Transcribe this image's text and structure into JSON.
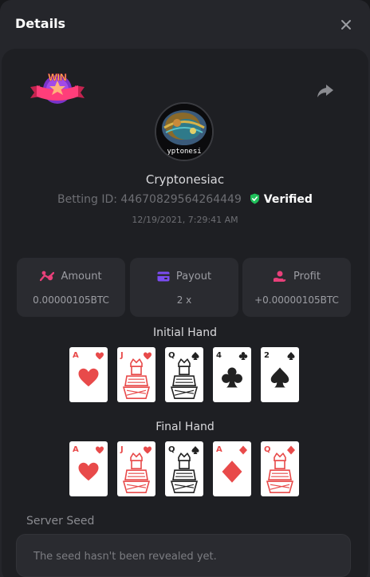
{
  "header": {
    "title": "Details"
  },
  "user": {
    "name": "Cryptonesiac",
    "avatar_text": "yptonesi",
    "betting_label": "Betting ID:",
    "betting_id": "44670829564264449",
    "verified_label": "Verified",
    "timestamp": "12/19/2021, 7:29:41 AM"
  },
  "badge": {
    "text": "WIN"
  },
  "stats": {
    "amount": {
      "label": "Amount",
      "value": "0.00000105BTC",
      "icon": "coins-icon"
    },
    "payout": {
      "label": "Payout",
      "value": "2 x",
      "icon": "wallet-icon"
    },
    "profit": {
      "label": "Profit",
      "value": "+0.00000105BTC",
      "icon": "hand-coins-icon"
    }
  },
  "initial_hand": {
    "title": "Initial Hand",
    "cards": [
      {
        "rank": "A",
        "suit": "hearts"
      },
      {
        "rank": "J",
        "suit": "hearts"
      },
      {
        "rank": "Q",
        "suit": "spades"
      },
      {
        "rank": "4",
        "suit": "clubs"
      },
      {
        "rank": "2",
        "suit": "spades"
      }
    ]
  },
  "final_hand": {
    "title": "Final Hand",
    "cards": [
      {
        "rank": "A",
        "suit": "hearts"
      },
      {
        "rank": "J",
        "suit": "hearts"
      },
      {
        "rank": "Q",
        "suit": "spades"
      },
      {
        "rank": "A",
        "suit": "diamonds"
      },
      {
        "rank": "Q",
        "suit": "diamonds"
      }
    ]
  },
  "server_seed": {
    "label": "Server Seed",
    "message": "The seed hasn't been revealed yet."
  },
  "colors": {
    "red_suit": "#e84a4a",
    "black_suit": "#222222",
    "verified_green": "#1fc05a",
    "accent_pink": "#e8407a",
    "accent_purple": "#7b4cf2"
  }
}
